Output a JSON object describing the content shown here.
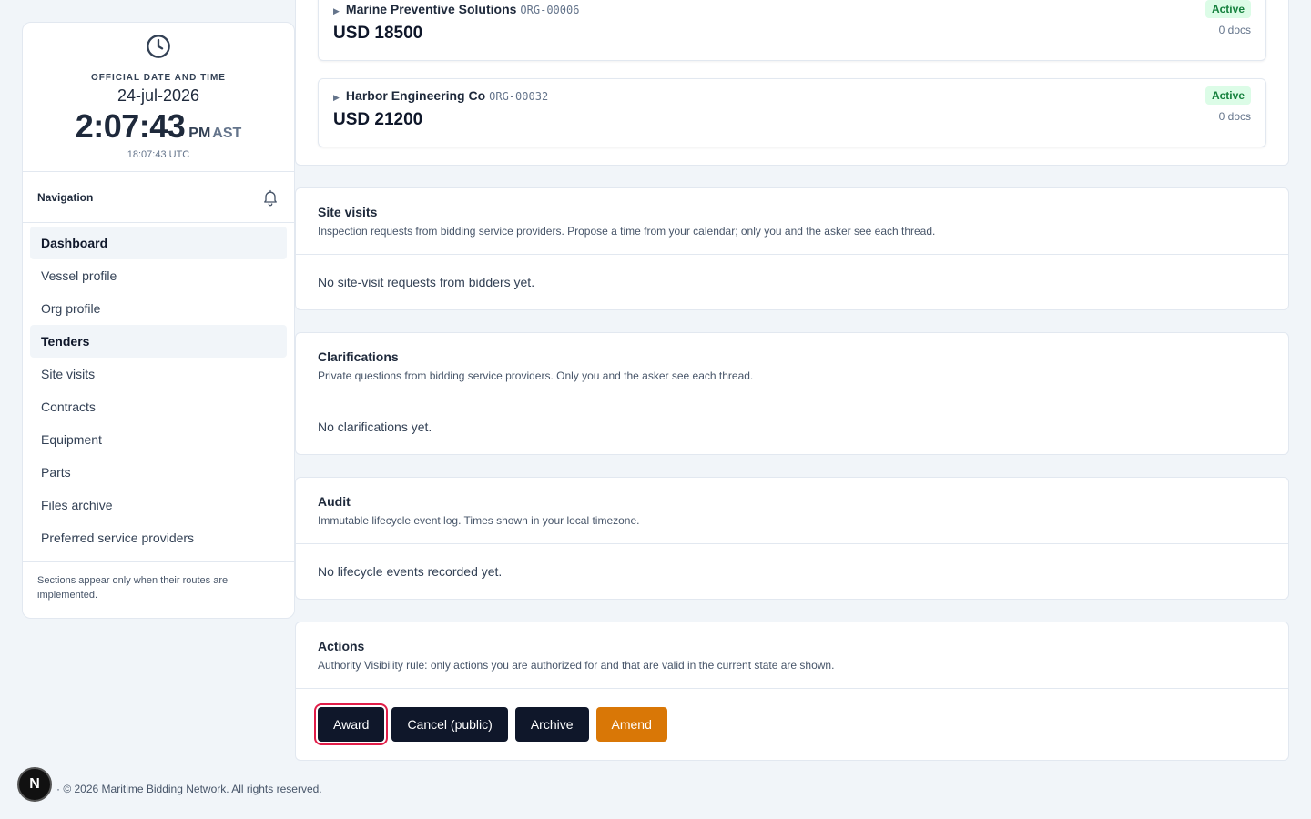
{
  "clock": {
    "label": "OFFICIAL DATE AND TIME",
    "date": "24-jul-2026",
    "time": "2:07:43",
    "ampm": "PM",
    "tz": "AST",
    "utc": "18:07:43 UTC"
  },
  "nav": {
    "title": "Navigation",
    "items": [
      {
        "label": "Dashboard"
      },
      {
        "label": "Vessel profile"
      },
      {
        "label": "Org profile"
      },
      {
        "label": "Tenders"
      },
      {
        "label": "Site visits"
      },
      {
        "label": "Contracts"
      },
      {
        "label": "Equipment"
      },
      {
        "label": "Parts"
      },
      {
        "label": "Files archive"
      },
      {
        "label": "Preferred service providers"
      }
    ],
    "note": "Sections appear only when their routes are implemented."
  },
  "bids": [
    {
      "name": "Marine Preventive Solutions",
      "org": "ORG-00006",
      "amount": "USD 18500",
      "status": "Active",
      "docs": "0 docs"
    },
    {
      "name": "Harbor Engineering Co",
      "org": "ORG-00032",
      "amount": "USD 21200",
      "status": "Active",
      "docs": "0 docs"
    }
  ],
  "site_visits": {
    "title": "Site visits",
    "desc": "Inspection requests from bidding service providers. Propose a time from your calendar; only you and the asker see each thread.",
    "empty": "No site-visit requests from bidders yet."
  },
  "clarifications": {
    "title": "Clarifications",
    "desc": "Private questions from bidding service providers. Only you and the asker see each thread.",
    "empty": "No clarifications yet."
  },
  "audit": {
    "title": "Audit",
    "desc": "Immutable lifecycle event log. Times shown in your local timezone.",
    "empty": "No lifecycle events recorded yet."
  },
  "actions": {
    "title": "Actions",
    "desc": "Authority Visibility rule: only actions you are authorized for and that are valid in the current state are shown.",
    "award": "Award",
    "cancel": "Cancel (public)",
    "archive": "Archive",
    "amend": "Amend"
  },
  "footer": "· © 2026 Maritime Bidding Network. All rights reserved.",
  "dev_badge": "N",
  "colors": {
    "accent": "#0f172a",
    "amend": "#d97706",
    "active_badge_bg": "#dcfce7",
    "active_badge_text": "#15803d",
    "focus_ring": "#e11d48"
  },
  "icons": [
    "clock-icon",
    "bell-icon",
    "caret-right-icon"
  ]
}
